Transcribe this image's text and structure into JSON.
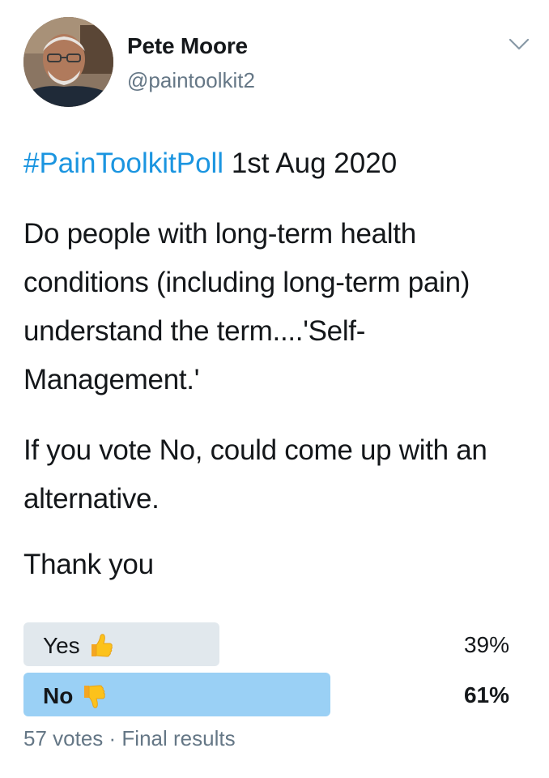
{
  "author": {
    "display_name": "Pete Moore",
    "handle": "@paintoolkit2",
    "avatar_icon": "avatar-photo"
  },
  "tweet": {
    "hashtag": "#PainToolkitPoll",
    "date_text": " 1st Aug 2020",
    "paragraphs": [
      "Do people with long-term health conditions (including long-term pain) understand the term....'Self-Management.'",
      "If you vote No, could come up with an alternative.",
      "Thank you"
    ]
  },
  "poll": {
    "options": [
      {
        "label": "Yes",
        "percent_text": "39%",
        "percent": 39,
        "emoji": "thumbs-up",
        "winner": false
      },
      {
        "label": "No",
        "percent_text": "61%",
        "percent": 61,
        "emoji": "thumbs-down",
        "winner": true
      }
    ],
    "votes_text": "57 votes",
    "separator": " · ",
    "status_text": "Final results"
  },
  "colors": {
    "hashtag": "#1b95e0",
    "winner_bar": "#9ad0f5",
    "loser_bar": "#e1e8ed",
    "secondary_text": "#657786"
  }
}
